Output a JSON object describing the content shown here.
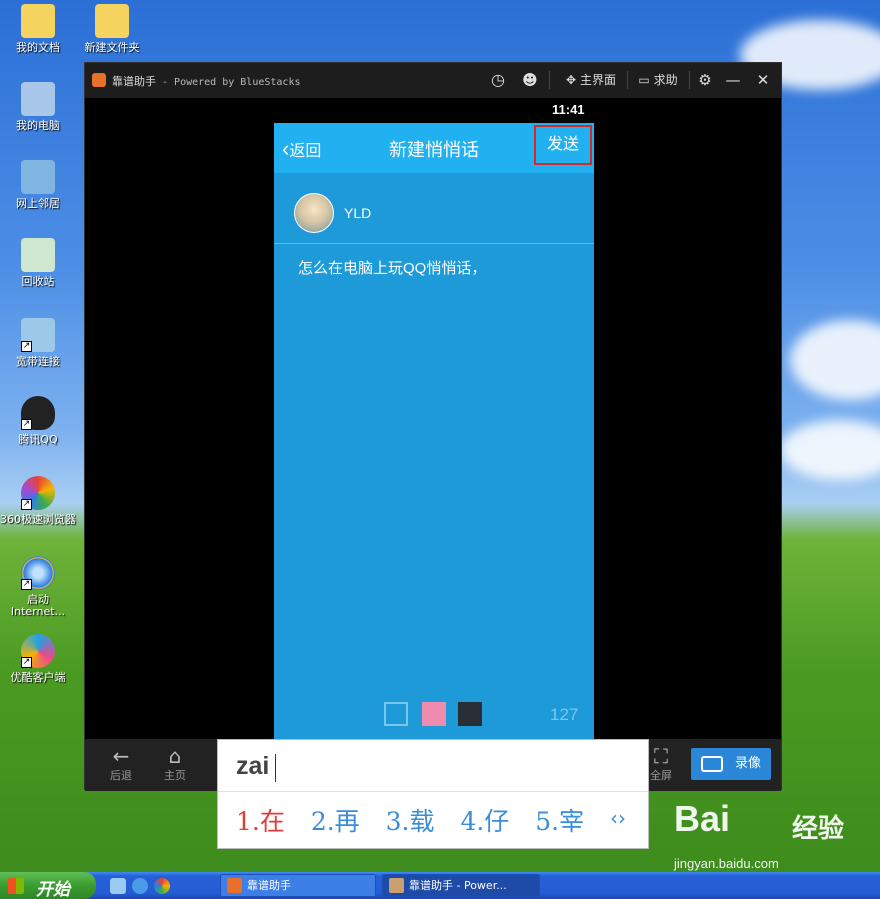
{
  "desktop": {
    "icons": [
      {
        "label": "我的文档"
      },
      {
        "label": "新建文件夹"
      },
      {
        "label": "我的电脑"
      },
      {
        "label": "网上邻居"
      },
      {
        "label": "回收站"
      },
      {
        "label": "宽带连接"
      },
      {
        "label": "腾讯QQ"
      },
      {
        "label": "360极速浏览器"
      },
      {
        "label": "启动 Internet..."
      },
      {
        "label": "优酷客户端"
      }
    ]
  },
  "emulator": {
    "title": "靠谱助手",
    "powered": " - Powered by BlueStacks",
    "toolbar": {
      "home_label": "主界面",
      "help_label": "求助"
    },
    "status_time": "11:41",
    "bottom": {
      "back_label": "后退",
      "home_label": "主页",
      "fullscreen_label": "全屏",
      "record_label": "录像"
    }
  },
  "app": {
    "back_label": "返回",
    "title": "新建悄悄话",
    "send_label": "发送",
    "recipient": "YLD",
    "message": "怎么在电脑上玩QQ悄悄话，",
    "char_count": "127",
    "swatch_colors": [
      "#1e9ad8",
      "#f08bb0",
      "#2a2f36"
    ]
  },
  "ime": {
    "composition": "zai",
    "candidates": [
      "1.在",
      "2.再",
      "3.载",
      "4.仔",
      "5.宰"
    ],
    "pager": "‹›"
  },
  "taskbar": {
    "start_label": "开始",
    "tasks": [
      {
        "label": "靠谱助手"
      },
      {
        "label": "靠谱助手 - Power..."
      }
    ]
  },
  "watermark": {
    "brand": "Bai",
    "brand_cn": "经验",
    "url": "jingyan.baidu.com"
  }
}
